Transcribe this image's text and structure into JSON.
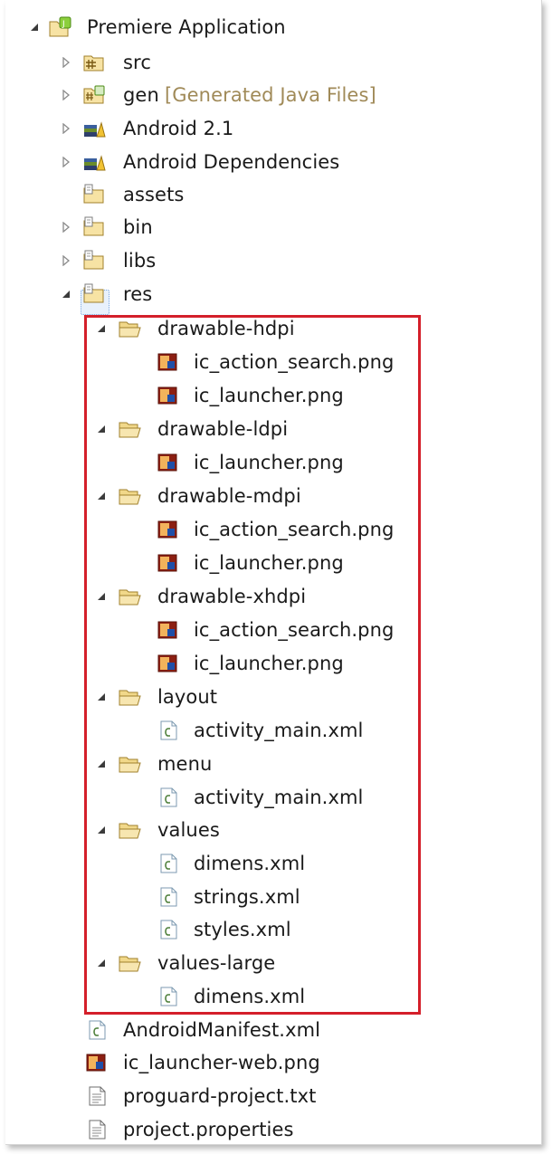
{
  "tree": {
    "root": {
      "label": "Premiere Application",
      "expanded": true
    },
    "src": {
      "label": "src"
    },
    "gen": {
      "label": "gen",
      "decoration": "[Generated Java Files]"
    },
    "android21": {
      "label": "Android 2.1"
    },
    "android_deps": {
      "label": "Android Dependencies"
    },
    "assets": {
      "label": "assets"
    },
    "bin": {
      "label": "bin"
    },
    "libs": {
      "label": "libs"
    },
    "res": {
      "label": "res",
      "expanded": true,
      "children": {
        "drawable_hdpi": {
          "label": "drawable-hdpi",
          "files": [
            "ic_action_search.png",
            "ic_launcher.png"
          ]
        },
        "drawable_ldpi": {
          "label": "drawable-ldpi",
          "files": [
            "ic_launcher.png"
          ]
        },
        "drawable_mdpi": {
          "label": "drawable-mdpi",
          "files": [
            "ic_action_search.png",
            "ic_launcher.png"
          ]
        },
        "drawable_xhdpi": {
          "label": "drawable-xhdpi",
          "files": [
            "ic_action_search.png",
            "ic_launcher.png"
          ]
        },
        "layout": {
          "label": "layout",
          "files": [
            "activity_main.xml"
          ]
        },
        "menu": {
          "label": "menu",
          "files": [
            "activity_main.xml"
          ]
        },
        "values": {
          "label": "values",
          "files": [
            "dimens.xml",
            "strings.xml",
            "styles.xml"
          ]
        },
        "values_large": {
          "label": "values-large",
          "files": [
            "dimens.xml"
          ]
        }
      }
    },
    "root_files": [
      "AndroidManifest.xml",
      "ic_launcher-web.png",
      "proguard-project.txt",
      "project.properties"
    ]
  },
  "colors": {
    "highlight_border": "#d41f2a",
    "folder_fill": "#f7e3a4",
    "decoration_text": "#a08a58"
  }
}
